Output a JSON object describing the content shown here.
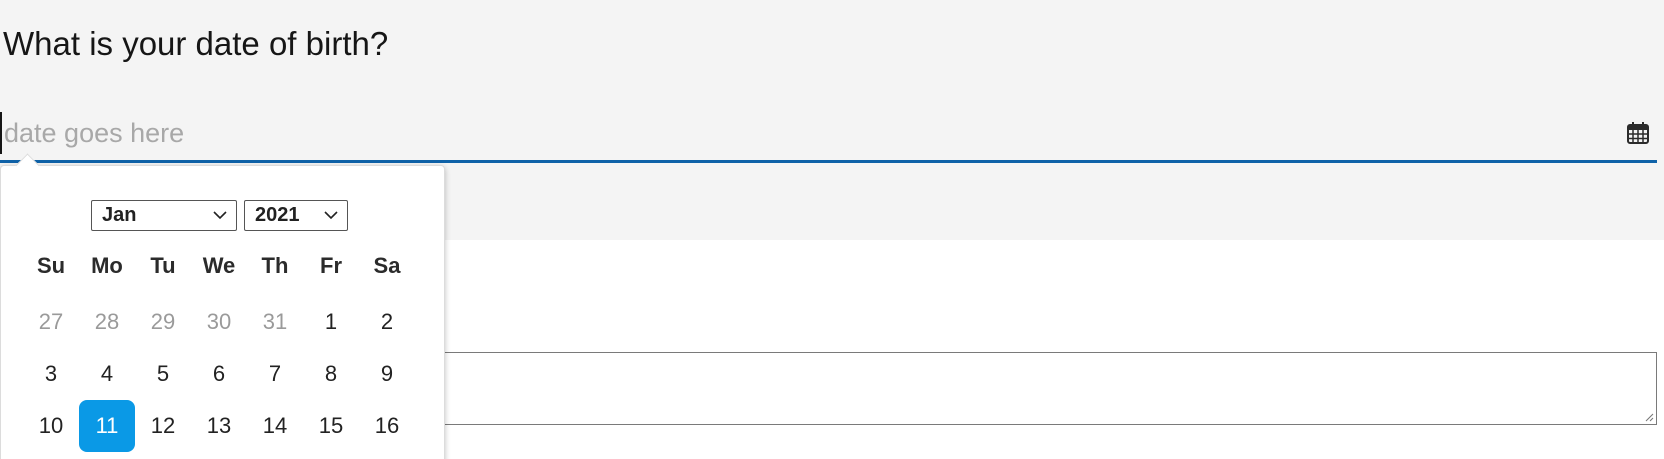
{
  "question": {
    "label": "What is your date of birth?"
  },
  "date_input": {
    "placeholder": "date goes here",
    "value": ""
  },
  "icons": {
    "calendar": "calendar-icon",
    "chevron": "chevron-down-icon"
  },
  "datepicker": {
    "month": "Jan",
    "year": "2021",
    "weekdays": [
      "Su",
      "Mo",
      "Tu",
      "We",
      "Th",
      "Fr",
      "Sa"
    ],
    "rows": [
      [
        {
          "day": "27",
          "muted": true
        },
        {
          "day": "28",
          "muted": true
        },
        {
          "day": "29",
          "muted": true
        },
        {
          "day": "30",
          "muted": true
        },
        {
          "day": "31",
          "muted": true
        },
        {
          "day": "1",
          "muted": false
        },
        {
          "day": "2",
          "muted": false
        }
      ],
      [
        {
          "day": "3",
          "muted": false
        },
        {
          "day": "4",
          "muted": false
        },
        {
          "day": "5",
          "muted": false
        },
        {
          "day": "6",
          "muted": false
        },
        {
          "day": "7",
          "muted": false
        },
        {
          "day": "8",
          "muted": false
        },
        {
          "day": "9",
          "muted": false
        }
      ],
      [
        {
          "day": "10",
          "muted": false
        },
        {
          "day": "11",
          "muted": false,
          "selected": true
        },
        {
          "day": "12",
          "muted": false
        },
        {
          "day": "13",
          "muted": false
        },
        {
          "day": "14",
          "muted": false
        },
        {
          "day": "15",
          "muted": false
        },
        {
          "day": "16",
          "muted": false
        }
      ]
    ]
  },
  "colors": {
    "accent": "#0f62a8",
    "selected_day": "#0a99e6",
    "panel_background": "#f4f4f4"
  }
}
